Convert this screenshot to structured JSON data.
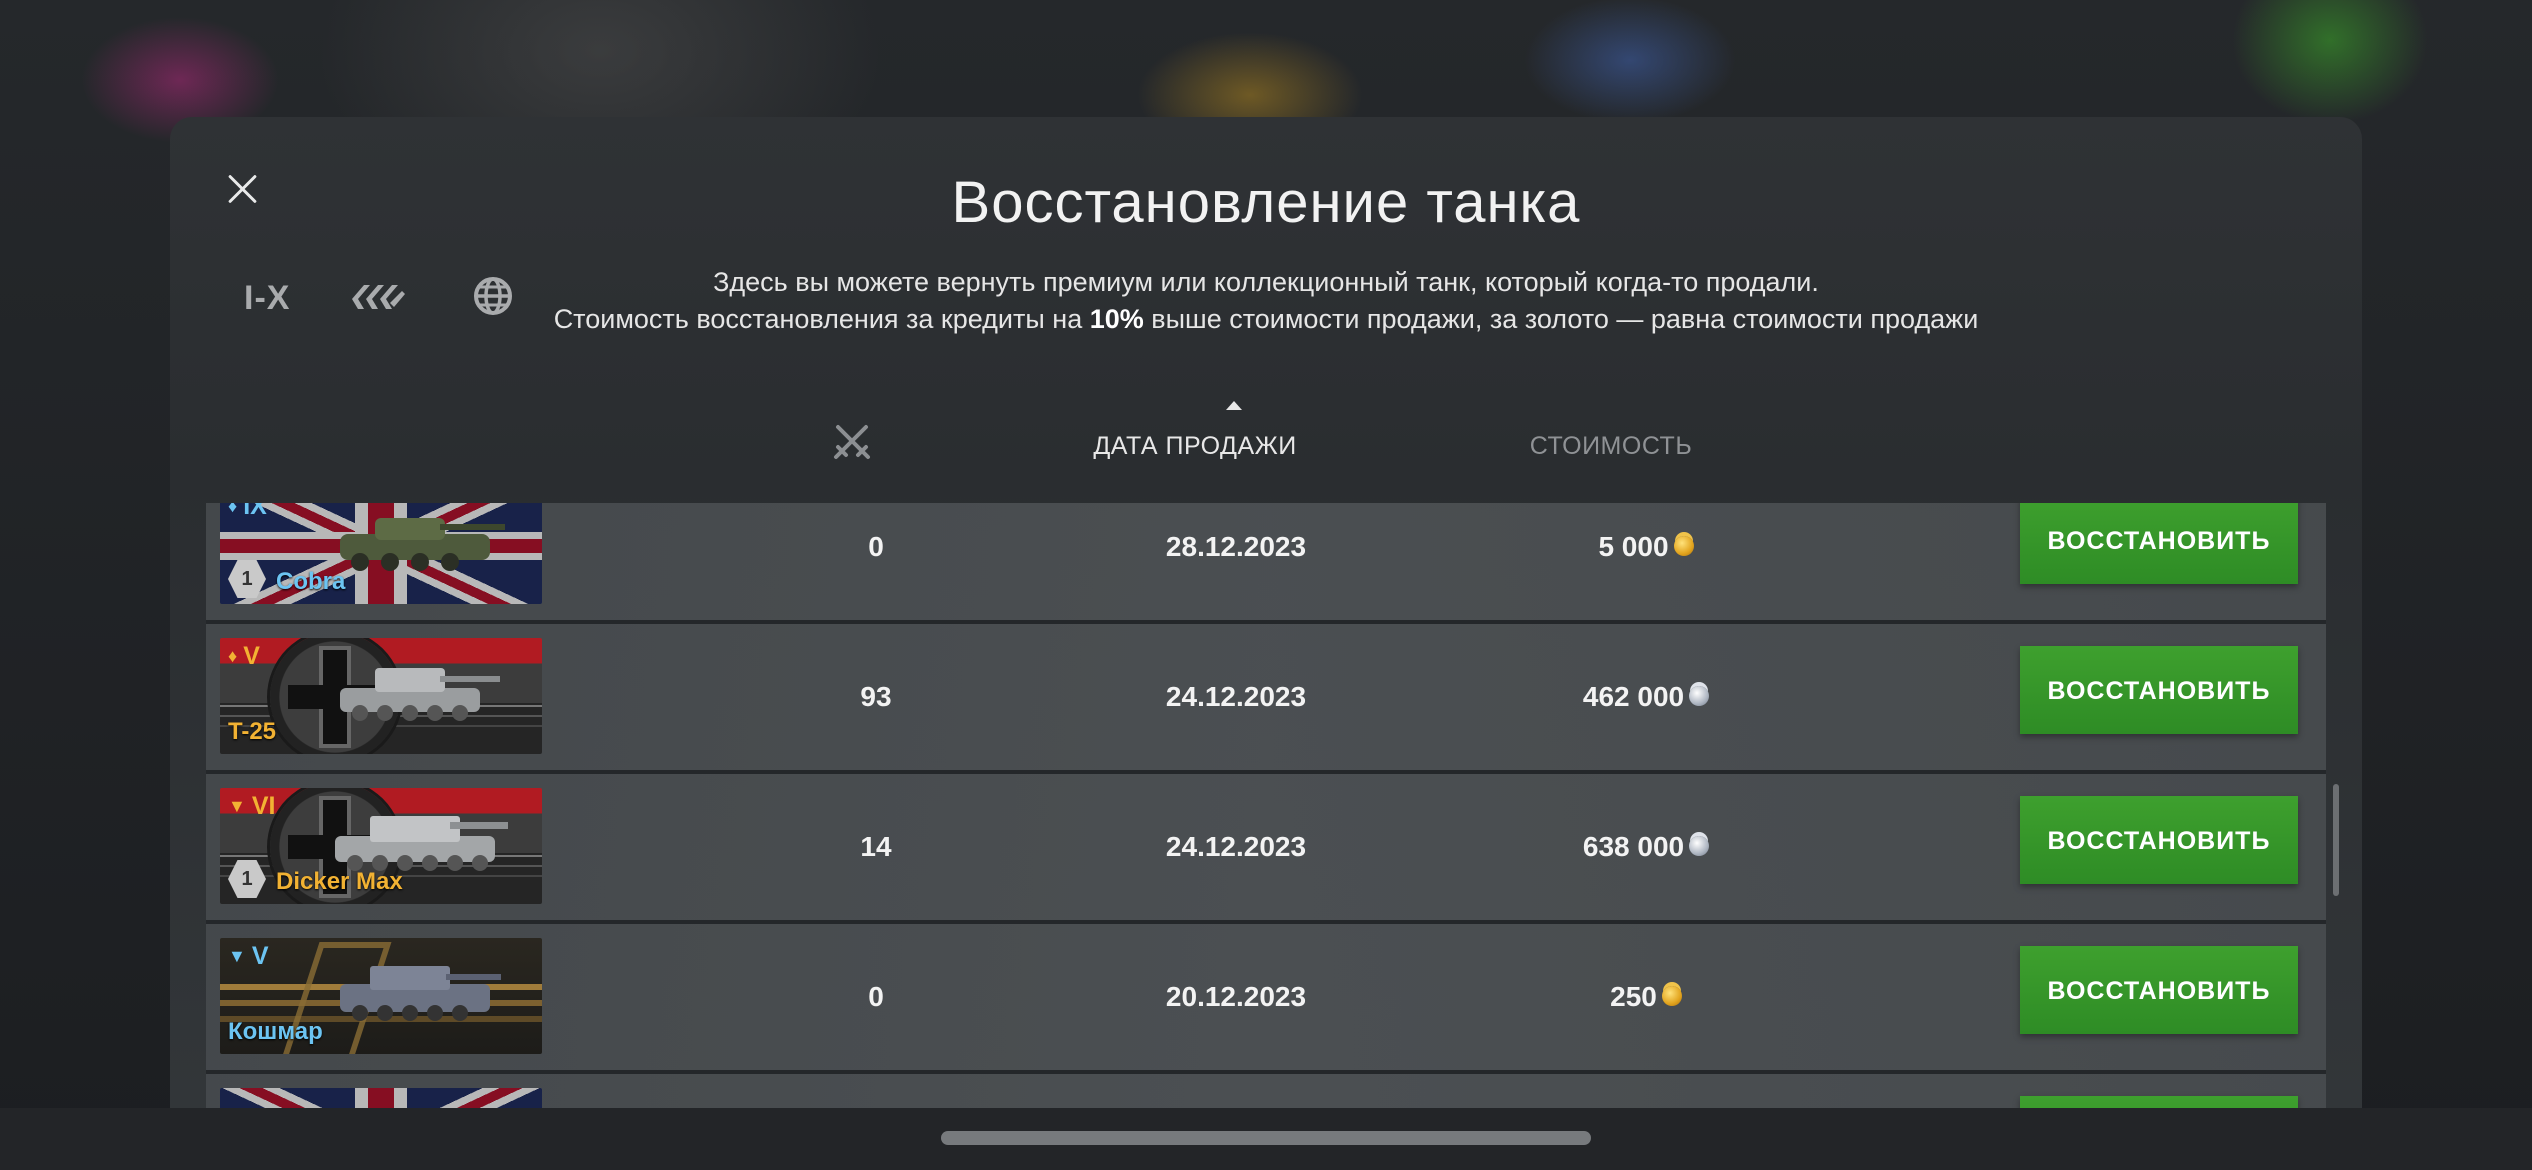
{
  "window": {
    "title": "Восстановление танка",
    "description_line1": "Здесь вы можете вернуть премиум или коллекционный танк, который когда-то продали.",
    "description_line2_prefix": "Стоимость восстановления за кредиты на ",
    "description_line2_bold": "10%",
    "description_line2_suffix": " выше стоимости продажи, за золото — равна стоимости продажи"
  },
  "filters": {
    "tier_label": "I-X",
    "type_icon": "vehicle-type-icon",
    "nation_icon": "globe-icon"
  },
  "columns": {
    "battles_icon": "crossed-swords-icon",
    "date": "ДАТА ПРОДАЖИ",
    "cost": "СТОИМОСТЬ",
    "sort": "ascending-arrow"
  },
  "rows": [
    {
      "tier": "IX",
      "name": "Cobra",
      "nation": "uk",
      "type": "collectible",
      "mastery": "1",
      "battles": "0",
      "date": "28.12.2023",
      "cost": "5 000",
      "currency": "gold",
      "button": "ВОССТАНОВИТЬ"
    },
    {
      "tier": "V",
      "name": "T-25",
      "nation": "germany",
      "type": "premium",
      "mastery": "",
      "battles": "93",
      "date": "24.12.2023",
      "cost": "462 000",
      "currency": "credits",
      "button": "ВОССТАНОВИТЬ"
    },
    {
      "tier": "VI",
      "name": "Dicker Max",
      "nation": "germany",
      "type": "premium",
      "mastery": "1",
      "battles": "14",
      "date": "24.12.2023",
      "cost": "638 000",
      "currency": "credits",
      "button": "ВОССТАНОВИТЬ"
    },
    {
      "tier": "V",
      "name": "Кошмар",
      "nation": "special",
      "type": "collectible",
      "mastery": "",
      "battles": "0",
      "date": "20.12.2023",
      "cost": "250",
      "currency": "gold",
      "button": "ВОССТАНОВИТЬ"
    }
  ],
  "colors": {
    "restore_button": "#35962a",
    "collectible_name": "#6cc4f2",
    "premium_name": "#f2b233"
  }
}
